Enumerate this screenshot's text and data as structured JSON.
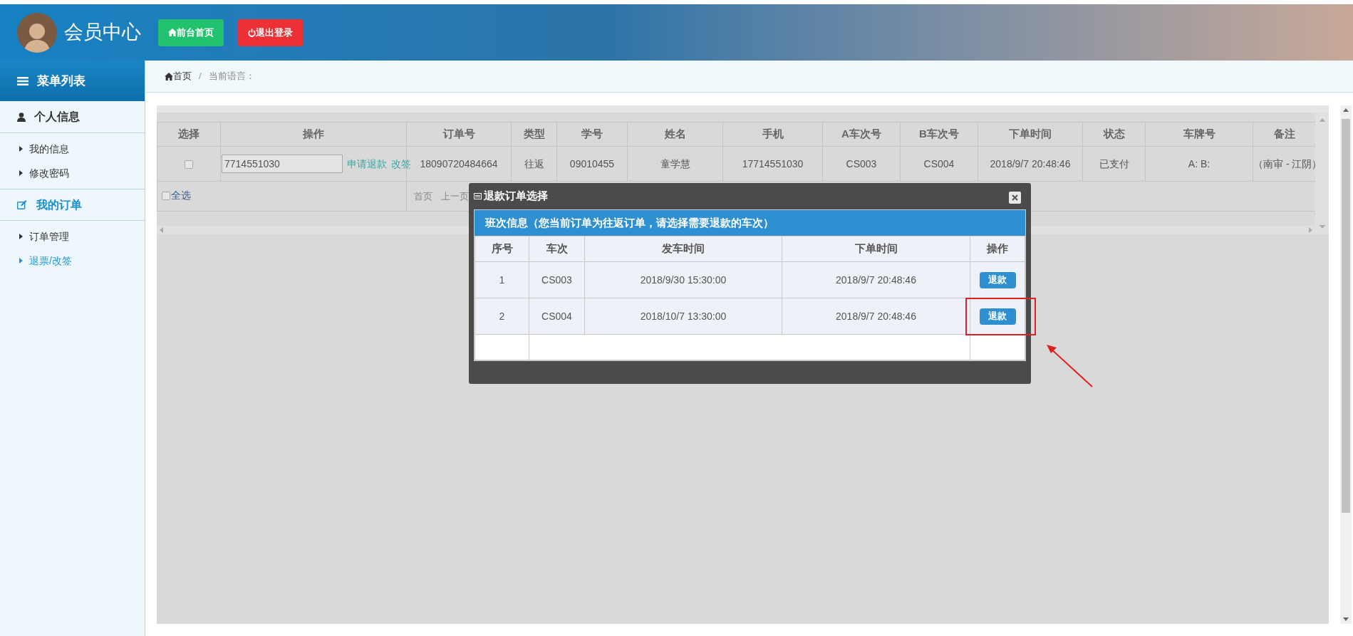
{
  "header": {
    "title": "会员中心",
    "buttons": [
      {
        "label": "前台首页",
        "kind": "home"
      },
      {
        "label": "退出登录",
        "kind": "logout"
      }
    ]
  },
  "sidebar": {
    "title": "菜单列表",
    "sections": [
      {
        "label": "个人信息",
        "kind": "user",
        "selected": false,
        "items": [
          {
            "label": "我的信息",
            "selected": false
          },
          {
            "label": "修改密码",
            "selected": false
          }
        ]
      },
      {
        "label": "我的订单",
        "kind": "edit",
        "selected": true,
        "items": [
          {
            "label": "订单管理",
            "selected": false
          },
          {
            "label": "退票/改签",
            "selected": true
          }
        ]
      }
    ]
  },
  "breadcrumb": {
    "home": "首页",
    "separator": "/",
    "language_label": "当前语言："
  },
  "orders_table": {
    "columns": [
      "选择",
      "操作",
      "订单号",
      "类型",
      "学号",
      "姓名",
      "手机",
      "A车次号",
      "B车次号",
      "下单时间",
      "状态",
      "车牌号",
      "备注"
    ],
    "rows": [
      {
        "cells": [
          {
            "kind": "checkbox",
            "checked": false
          },
          {
            "kind": "operation",
            "input_value": "7714551030",
            "actions": [
              "申请退款",
              "改签"
            ]
          },
          "18090720484664",
          "往返",
          "09010455",
          "童学慧",
          "17714551030",
          "CS003",
          "CS004",
          "2018/9/7 20:48:46",
          "已支付",
          "A: B:",
          "（南审 - 江阴）"
        ]
      }
    ],
    "select_all": {
      "label": "全选",
      "checked": false
    },
    "pagination": [
      "首页",
      "上一页"
    ]
  },
  "dialog": {
    "title": "退款订单选择",
    "section_title": "班次信息（您当前订单为往返订单，请选择需要退款的车次）",
    "columns": [
      "序号",
      "车次",
      "发车时间",
      "下单时间",
      "操作"
    ],
    "rows": [
      {
        "cells": [
          "1",
          "CS003",
          "2018/9/30 15:30:00",
          "2018/9/7 20:48:46"
        ],
        "button": "退款",
        "highlighted": false
      },
      {
        "cells": [
          "2",
          "CS004",
          "2018/10/7 13:30:00",
          "2018/9/7 20:48:46"
        ],
        "button": "退款",
        "highlighted": true
      }
    ]
  }
}
